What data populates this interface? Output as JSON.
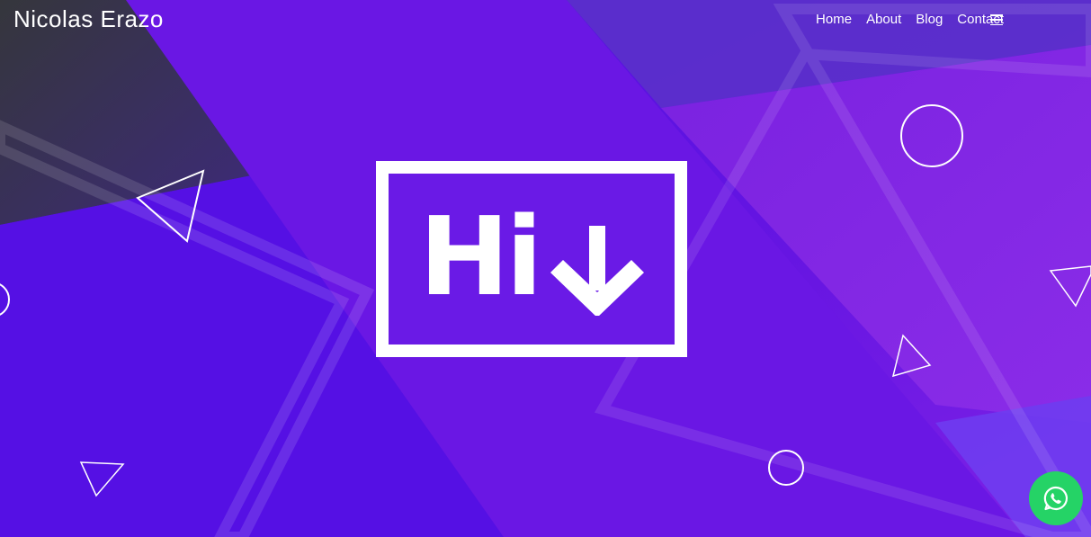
{
  "brand": {
    "name": "Nicolas Erazo"
  },
  "nav": {
    "items": [
      {
        "label": "Home"
      },
      {
        "label": "About"
      },
      {
        "label": "Blog"
      },
      {
        "label": "Contact"
      }
    ],
    "menu_icon": "hamburger-icon"
  },
  "hero": {
    "text": "Hi",
    "arrow_icon": "arrow-down-icon"
  },
  "floating": {
    "whatsapp_icon": "whatsapp-icon"
  },
  "colors": {
    "background": "#5a10e0",
    "accent_purple": "#6a1ae6",
    "whatsapp_green": "#25d366",
    "text": "#ffffff"
  }
}
